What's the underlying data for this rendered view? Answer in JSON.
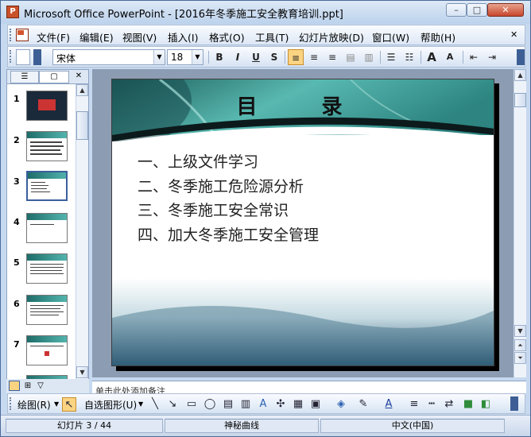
{
  "window": {
    "title": "Microsoft Office PowerPoint - [2016年冬季施工安全教育培训.ppt]",
    "min_symbol": "–",
    "max_symbol": "□",
    "close_symbol": "✕"
  },
  "menu": {
    "items": [
      "文件(F)",
      "编辑(E)",
      "视图(V)",
      "插入(I)",
      "格式(O)",
      "工具(T)",
      "幻灯片放映(D)",
      "窗口(W)",
      "帮助(H)"
    ],
    "close_symbol": "✕"
  },
  "format_toolbar": {
    "font_name": "宋体",
    "font_size": "18",
    "bold": "B",
    "italic": "I",
    "underline": "U",
    "shadow": "S",
    "align_left": "≡",
    "align_center": "≡",
    "align_right": "≡",
    "bullets": "☰",
    "numbering": "☷",
    "grow_font": "A",
    "shrink_font": "A"
  },
  "left_pane": {
    "tabs": [
      "☰",
      "▢"
    ],
    "close_symbol": "✕",
    "slides": [
      {
        "num": "1",
        "dark": true,
        "selected": false
      },
      {
        "num": "2",
        "dark": false,
        "selected": false
      },
      {
        "num": "3",
        "dark": false,
        "selected": true
      },
      {
        "num": "4",
        "dark": false,
        "selected": false
      },
      {
        "num": "5",
        "dark": false,
        "selected": false
      },
      {
        "num": "6",
        "dark": false,
        "selected": false
      },
      {
        "num": "7",
        "dark": false,
        "selected": false
      }
    ]
  },
  "slide": {
    "title": "目 录",
    "lines": [
      "一、上级文件学习",
      "二、冬季施工危险源分析",
      "三、冬季施工安全常识",
      "四、加大冬季施工安全管理"
    ],
    "header_color": "#2f8c87"
  },
  "notes": {
    "text": "单击此处添加备注"
  },
  "draw_toolbar": {
    "draw_label": "绘图(R)",
    "autoshapes_label": "自选图形(U)"
  },
  "status": {
    "slide_info": "幻灯片 3 / 44",
    "design": "神秘曲线",
    "language": "中文(中国)"
  }
}
